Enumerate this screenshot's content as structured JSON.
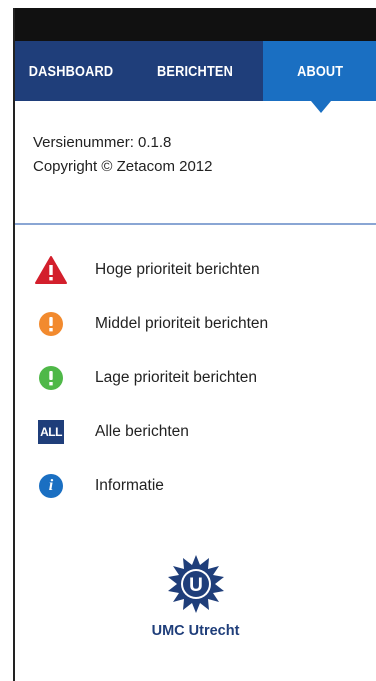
{
  "tabs": [
    {
      "label": "DASHBOARD",
      "active": false
    },
    {
      "label": "BERICHTEN",
      "active": false
    },
    {
      "label": "ABOUT",
      "active": true
    }
  ],
  "about": {
    "version_line": "Versienummer: 0.1.8",
    "copyright_line": "Copyright © Zetacom 2012"
  },
  "legend": [
    {
      "icon": "warning-triangle-icon",
      "color": "#d31f2c",
      "label": "Hoge prioriteit berichten"
    },
    {
      "icon": "exclamation-circle-icon",
      "color": "#f28a2e",
      "label": "Middel prioriteit berichten"
    },
    {
      "icon": "exclamation-circle-icon",
      "color": "#4fb848",
      "label": "Lage prioriteit berichten"
    },
    {
      "icon": "all-box-icon",
      "color": "#1f3e7a",
      "icon_text": "ALL",
      "label": "Alle berichten"
    },
    {
      "icon": "info-circle-icon",
      "color": "#1a6fc2",
      "icon_text": "i",
      "label": "Informatie"
    }
  ],
  "logo": {
    "name": "UMC Utrecht",
    "emblem_letter": "U",
    "color": "#1f3e7a"
  },
  "colors": {
    "tab_bar": "#1f3e7a",
    "tab_active": "#1a6fc2",
    "status_bar": "#111111",
    "divider": "#8aa6d4"
  }
}
